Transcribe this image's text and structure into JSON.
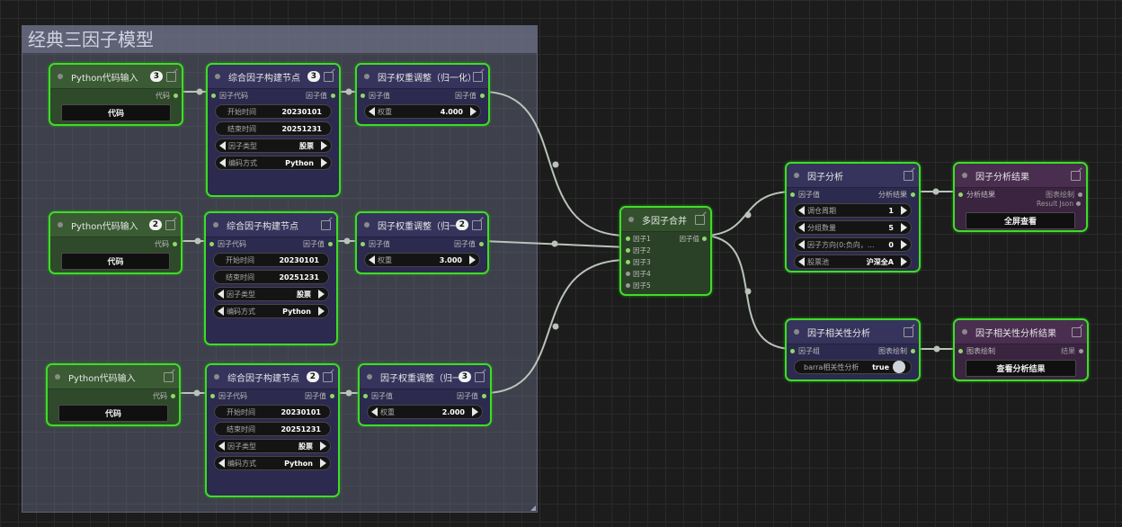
{
  "group": {
    "title": "经典三因子模型"
  },
  "rows": [
    {
      "python": {
        "title": "Python代码输入",
        "badge": "3",
        "out": "代码",
        "button": "代码"
      },
      "factor": {
        "title": "综合因子构建节点",
        "badge": "3",
        "in": "因子代码",
        "out": "因子值",
        "start_label": "开始时间",
        "start": "20230101",
        "end_label": "结束时间",
        "end": "20251231",
        "type_label": "因子类型",
        "type": "股票",
        "enc_label": "编码方式",
        "enc": "Python"
      },
      "weight": {
        "title": "因子权重调整（归一化）",
        "badge": "",
        "in": "因子值",
        "out": "因子值",
        "w_label": "权重",
        "w": "4.000"
      }
    },
    {
      "python": {
        "title": "Python代码输入",
        "badge": "2",
        "out": "代码",
        "button": "代码"
      },
      "factor": {
        "title": "综合因子构建节点",
        "badge": "",
        "in": "因子代码",
        "out": "因子值",
        "start_label": "开始时间",
        "start": "20230101",
        "end_label": "结束时间",
        "end": "20251231",
        "type_label": "因子类型",
        "type": "股票",
        "enc_label": "编码方式",
        "enc": "Python"
      },
      "weight": {
        "title": "因子权重调整（归一化）",
        "badge": "2",
        "in": "因子值",
        "out": "因子值",
        "w_label": "权重",
        "w": "3.000"
      }
    },
    {
      "python": {
        "title": "Python代码输入",
        "badge": "",
        "out": "代码",
        "button": "代码"
      },
      "factor": {
        "title": "综合因子构建节点",
        "badge": "2",
        "in": "因子代码",
        "out": "因子值",
        "start_label": "开始时间",
        "start": "20230101",
        "end_label": "结束时间",
        "end": "20251231",
        "type_label": "因子类型",
        "type": "股票",
        "enc_label": "编码方式",
        "enc": "Python"
      },
      "weight": {
        "title": "因子权重调整（归一化）",
        "badge": "3",
        "in": "因子值",
        "out": "因子值",
        "w_label": "权重",
        "w": "2.000"
      }
    }
  ],
  "merge": {
    "title": "多因子合并",
    "inputs": [
      "因子1",
      "因子2",
      "因子3",
      "因子4",
      "因子5"
    ],
    "out": "因子值"
  },
  "analysis": {
    "title": "因子分析",
    "in": "因子值",
    "out": "分析结果",
    "period_label": "调仓周期",
    "period": "1",
    "groups_label": "分组数量",
    "groups": "5",
    "dir_label": "因子方向(0:负向，...",
    "dir": "0",
    "pool_label": "股票池",
    "pool": "沪深全A"
  },
  "result": {
    "title": "因子分析结果",
    "in": "分析结果",
    "out1": "图表绘制",
    "out2": "Result Json",
    "button": "全屏查看"
  },
  "corr": {
    "title": "因子相关性分析",
    "in": "因子组",
    "out": "图表绘制",
    "toggle_label": "barra相关性分析",
    "toggle": "true"
  },
  "corr_result": {
    "title": "因子相关性分析结果",
    "in": "图表绘制",
    "out": "结果",
    "button": "查看分析结果"
  }
}
